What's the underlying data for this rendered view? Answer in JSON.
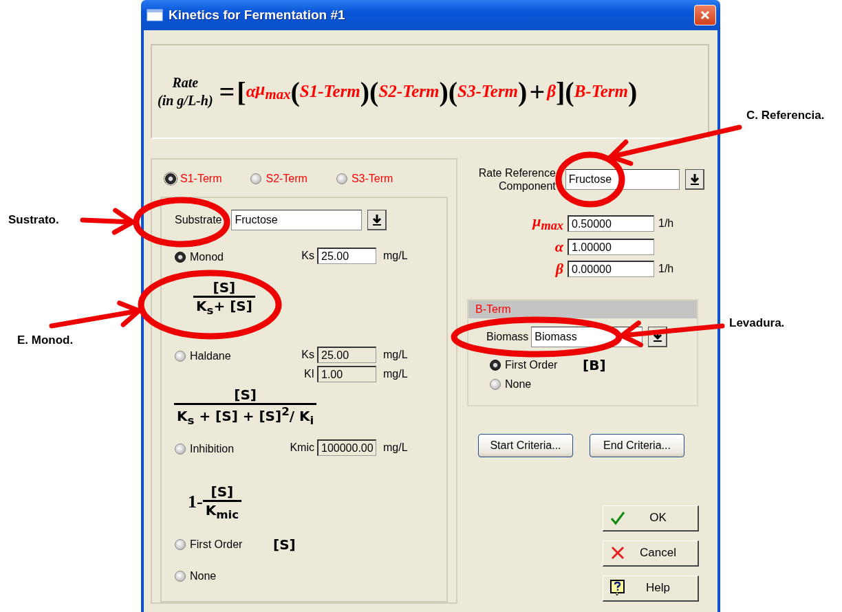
{
  "window": {
    "title": "Kinetics for Fermentation #1"
  },
  "rate_equation": {
    "label": "Rate",
    "unit": "(in g/L-h)",
    "tokens": [
      {
        "text": "=",
        "kind": "op"
      },
      {
        "text": "[",
        "kind": "bracket"
      },
      {
        "text": "α",
        "kind": "var"
      },
      {
        "text": "μ$_{max}$",
        "kind": "var"
      },
      {
        "text": "(",
        "kind": "bracket"
      },
      {
        "text": "S1-Term",
        "kind": "var"
      },
      {
        "text": ")",
        "kind": "bracket"
      },
      {
        "text": "(",
        "kind": "bracket"
      },
      {
        "text": "S2-Term",
        "kind": "var"
      },
      {
        "text": ")",
        "kind": "bracket"
      },
      {
        "text": "(",
        "kind": "bracket"
      },
      {
        "text": "S3-Term",
        "kind": "var"
      },
      {
        "text": ")",
        "kind": "bracket"
      },
      {
        "text": "+",
        "kind": "op"
      },
      {
        "text": "β",
        "kind": "var"
      },
      {
        "text": "]",
        "kind": "bracket"
      },
      {
        "text": "(",
        "kind": "bracket"
      },
      {
        "text": "B-Term",
        "kind": "var"
      },
      {
        "text": ")",
        "kind": "bracket"
      }
    ]
  },
  "substrate_terms": [
    {
      "label": "S1-Term",
      "selected": true
    },
    {
      "label": "S2-Term",
      "selected": false
    },
    {
      "label": "S3-Term",
      "selected": false
    }
  ],
  "substrate": {
    "label": "Substrate",
    "value": "Fructose"
  },
  "models": [
    {
      "label": "Monod",
      "selected": true,
      "params": [
        {
          "name": "Ks",
          "value": "25.00",
          "unit": "mg/L",
          "disabled": false
        }
      ],
      "formula": {
        "kind": "fraction",
        "numerator": "[S]",
        "denominator": "K$_{s}$+ [S]"
      }
    },
    {
      "label": "Haldane",
      "selected": false,
      "params": [
        {
          "name": "Ks",
          "value": "25.00",
          "unit": "mg/L",
          "disabled": true
        },
        {
          "name": "KI",
          "value": "1.00",
          "unit": "mg/L",
          "disabled": true
        }
      ],
      "formula": {
        "kind": "fraction",
        "numerator": "[S]",
        "denominator": "K$_{s}$ + [S] + [S]$^{2}$/ K$_{i}$"
      }
    },
    {
      "label": "Inhibition",
      "selected": false,
      "params": [
        {
          "name": "Kmic",
          "value": "100000.00",
          "unit": "mg/L",
          "disabled": true
        }
      ],
      "formula": {
        "kind": "fraction",
        "prefix": "1-",
        "numerator": "[S]",
        "denominator": "K$_{mic}$"
      }
    },
    {
      "label": "First Order",
      "selected": false,
      "formula": {
        "kind": "inline",
        "text": "[S]"
      }
    },
    {
      "label": "None",
      "selected": false
    }
  ],
  "rate_reference": {
    "label": "Rate Reference Component",
    "value": "Fructose"
  },
  "rate_constants": [
    {
      "symbol": "μ$_{max}$",
      "value": "0.50000",
      "unit": "1/h"
    },
    {
      "symbol": "α",
      "value": "1.00000"
    },
    {
      "symbol": "β",
      "value": "0.00000",
      "unit": "1/h"
    }
  ],
  "b_term": {
    "title": "B-Term",
    "label": "Biomass",
    "value": "Biomass",
    "options": [
      {
        "label": "First Order",
        "selected": true,
        "formula": "[B]"
      },
      {
        "label": "None",
        "selected": false
      }
    ]
  },
  "criteria_buttons": [
    "Start Criteria...",
    "End Criteria..."
  ],
  "dialog_buttons": [
    {
      "label": "OK",
      "kind": "ok"
    },
    {
      "label": "Cancel",
      "kind": "cancel"
    },
    {
      "label": "Help",
      "kind": "help"
    }
  ],
  "annotations": [
    {
      "label": "Sustrato."
    },
    {
      "label": "E. Monod."
    },
    {
      "label": "C. Referencia."
    },
    {
      "label": "Levadura."
    }
  ]
}
